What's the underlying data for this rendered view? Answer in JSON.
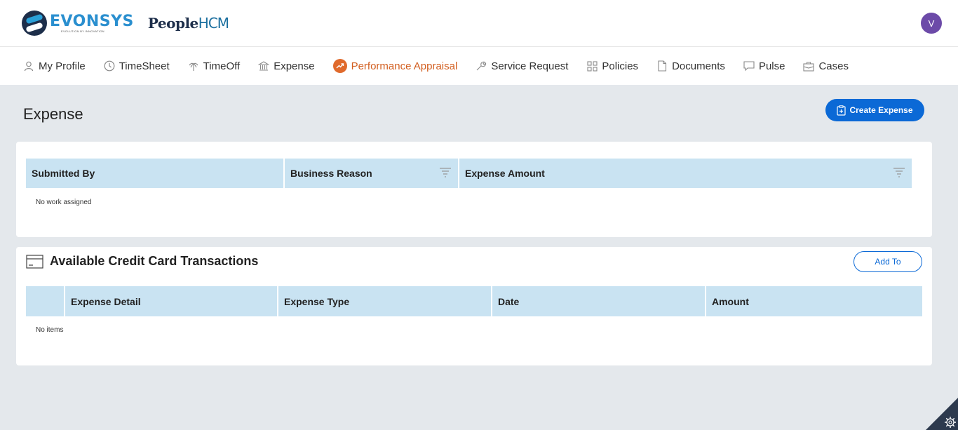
{
  "brand": {
    "name": "EVONSYS",
    "tagline": "EVOLUTION BY INNOVATION",
    "product": "PeopleHCM",
    "product_prefix": "People",
    "product_suffix": "HCM"
  },
  "user": {
    "avatar_initial": "V"
  },
  "nav": {
    "items": [
      {
        "label": "My Profile",
        "icon": "user-icon",
        "active": false
      },
      {
        "label": "TimeSheet",
        "icon": "clock-icon",
        "active": false
      },
      {
        "label": "TimeOff",
        "icon": "palm-tree-icon",
        "active": false
      },
      {
        "label": "Expense",
        "icon": "bank-icon",
        "active": false
      },
      {
        "label": "Performance Appraisal",
        "icon": "trend-up-icon",
        "active": true
      },
      {
        "label": "Service Request",
        "icon": "wrench-icon",
        "active": false
      },
      {
        "label": "Policies",
        "icon": "grid-icon",
        "active": false
      },
      {
        "label": "Documents",
        "icon": "document-icon",
        "active": false
      },
      {
        "label": "Pulse",
        "icon": "chat-icon",
        "active": false
      },
      {
        "label": "Cases",
        "icon": "briefcase-icon",
        "active": false
      }
    ]
  },
  "page": {
    "title": "Expense",
    "create_button": "Create Expense"
  },
  "expense_table": {
    "columns": [
      "Submitted By",
      "Business Reason",
      "Expense Amount"
    ],
    "empty_text": "No work assigned"
  },
  "credit_card": {
    "title": "Available Credit Card Transactions",
    "add_button": "Add To",
    "columns": [
      "",
      "Expense Detail",
      "Expense Type",
      "Date",
      "Amount"
    ],
    "empty_text": "No items"
  },
  "colors": {
    "accent": "#0b69d6",
    "active_nav": "#d25e1f",
    "header_cell": "#c9e3f2",
    "background": "#e4e8ec",
    "avatar": "#6c4aa8"
  }
}
